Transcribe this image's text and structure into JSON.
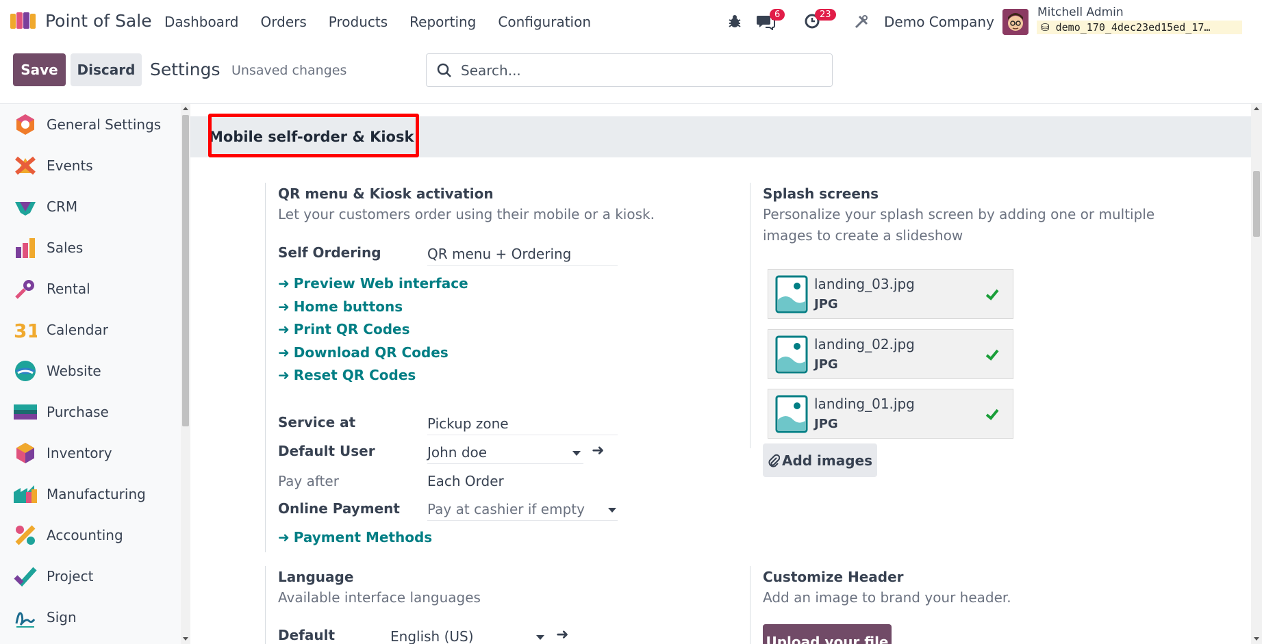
{
  "navbar": {
    "app_title": "Point of Sale",
    "menu": [
      "Dashboard",
      "Orders",
      "Products",
      "Reporting",
      "Configuration"
    ],
    "messages_count": "6",
    "activities_count": "23",
    "company": "Demo Company",
    "user_name": "Mitchell Admin",
    "database": "demo_170_4dec23ed15ed_17…"
  },
  "control_panel": {
    "save_label": "Save",
    "discard_label": "Discard",
    "title": "Settings",
    "status": "Unsaved changes",
    "search_placeholder": "Search..."
  },
  "sidebar": {
    "items": [
      {
        "label": "General Settings",
        "icon": "general-settings-icon"
      },
      {
        "label": "Events",
        "icon": "events-icon"
      },
      {
        "label": "CRM",
        "icon": "crm-icon"
      },
      {
        "label": "Sales",
        "icon": "sales-icon"
      },
      {
        "label": "Rental",
        "icon": "rental-icon"
      },
      {
        "label": "Calendar",
        "icon": "calendar-icon"
      },
      {
        "label": "Website",
        "icon": "website-icon"
      },
      {
        "label": "Purchase",
        "icon": "purchase-icon"
      },
      {
        "label": "Inventory",
        "icon": "inventory-icon"
      },
      {
        "label": "Manufacturing",
        "icon": "manufacturing-icon"
      },
      {
        "label": "Accounting",
        "icon": "accounting-icon"
      },
      {
        "label": "Project",
        "icon": "project-icon"
      },
      {
        "label": "Sign",
        "icon": "sign-icon"
      }
    ],
    "calendar_icon_text": "31"
  },
  "section": {
    "title": "Mobile self-order & Kiosk",
    "qr": {
      "title": "QR menu & Kiosk activation",
      "desc": "Let your customers order using their mobile or a kiosk.",
      "self_ordering_label": "Self Ordering",
      "self_ordering_value": "QR menu + Ordering",
      "links": [
        "Preview Web interface",
        "Home buttons",
        "Print QR Codes",
        "Download QR Codes",
        "Reset QR Codes"
      ],
      "service_at_label": "Service at",
      "service_at_value": "Pickup zone",
      "default_user_label": "Default User",
      "default_user_value": "John doe",
      "pay_after_label": "Pay after",
      "pay_after_value": "Each Order",
      "online_payment_label": "Online Payment",
      "online_payment_value": "Pay at cashier if empty",
      "payment_methods_link": "Payment Methods"
    },
    "splash": {
      "title": "Splash screens",
      "desc_line1": "Personalize your splash screen by adding one or multiple",
      "desc_line2": "images to create a slideshow",
      "files": [
        {
          "name": "landing_03.jpg",
          "type": "JPG"
        },
        {
          "name": "landing_02.jpg",
          "type": "JPG"
        },
        {
          "name": "landing_01.jpg",
          "type": "JPG"
        }
      ],
      "add_images_label": "Add images"
    },
    "language": {
      "title": "Language",
      "desc": "Available interface languages",
      "default_label": "Default",
      "default_value": "English (US)"
    },
    "header": {
      "title": "Customize Header",
      "desc": "Add an image to brand your header.",
      "upload_label": "Upload your file"
    }
  },
  "colors": {
    "brand": "#714b67",
    "link": "#017e84",
    "badge": "#e11d48",
    "highlight": "#ff0000"
  }
}
